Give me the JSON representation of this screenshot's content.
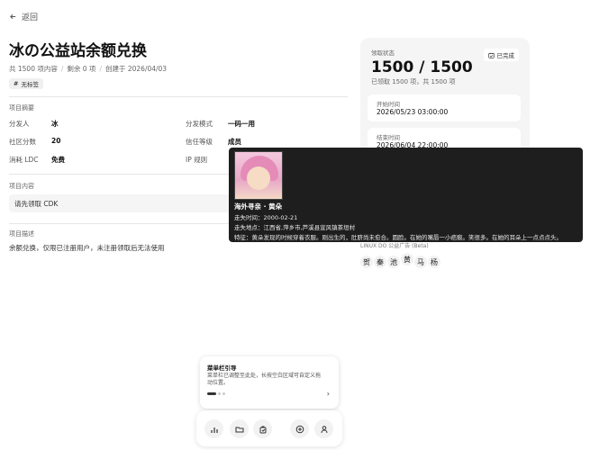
{
  "nav": {
    "back_label": "返回"
  },
  "project": {
    "title": "冰の公益站余额兑换",
    "meta": {
      "total": "共 1500 项内容",
      "remaining": "剩余 0 项",
      "created": "创建于 2026/04/03"
    },
    "tag": "无标签"
  },
  "summary": {
    "section_label": "项目摘要",
    "rows": [
      {
        "k1": "分发人",
        "v1": "冰",
        "k2": "分发模式",
        "v2": "一码一用"
      },
      {
        "k1": "社区分数",
        "v1": "20",
        "k2": "信任等级",
        "v2": "成员"
      },
      {
        "k1": "消耗 LDC",
        "v1": "免费",
        "k2": "IP 规则",
        "v2": ""
      }
    ]
  },
  "content": {
    "section_label": "项目内容",
    "text": "请先领取 CDK"
  },
  "description": {
    "section_label": "项目描述",
    "text": "余额兑换，仅限已注册用户，未注册领取后无法使用"
  },
  "status_card": {
    "label": "领取状态",
    "badge": "已完成",
    "count": "1500 / 1500",
    "sub": "已领取 1500 项，共 1500 项",
    "start_label": "开始时间",
    "start_value": "2026/05/23 03:00:00",
    "end_label": "结束时间",
    "end_value": "2026/06/04 22:00:00"
  },
  "tooltip": {
    "name": "海外寻亲 · 黄朵",
    "missing_time": "走失时间：2000-02-21",
    "missing_place": "走失地点：江西省,萍乡市,芦溪县宣风镇茶垣村",
    "features": "特征：黄朵发现的时候穿着衣服。刚出生的，肚脐尚未愈合。圆脸。在她的嘴唇一小疤痕。笑很多。在她的耳朵上一点点点头。"
  },
  "linuxdo": {
    "text": "LINUX DO 公益广告 (Beta)",
    "chars": [
      "贺",
      "秦",
      "池",
      "黄",
      "马",
      "杨"
    ]
  },
  "guide": {
    "title": "菜单栏引导",
    "desc": "菜单栏已调整至此处，长按空白区域可自定义拖动位置。",
    "next": "›"
  },
  "toolbar": {
    "icons": [
      "chart-icon",
      "folder-icon",
      "bag-icon",
      "plus-circle-icon",
      "user-icon"
    ]
  }
}
